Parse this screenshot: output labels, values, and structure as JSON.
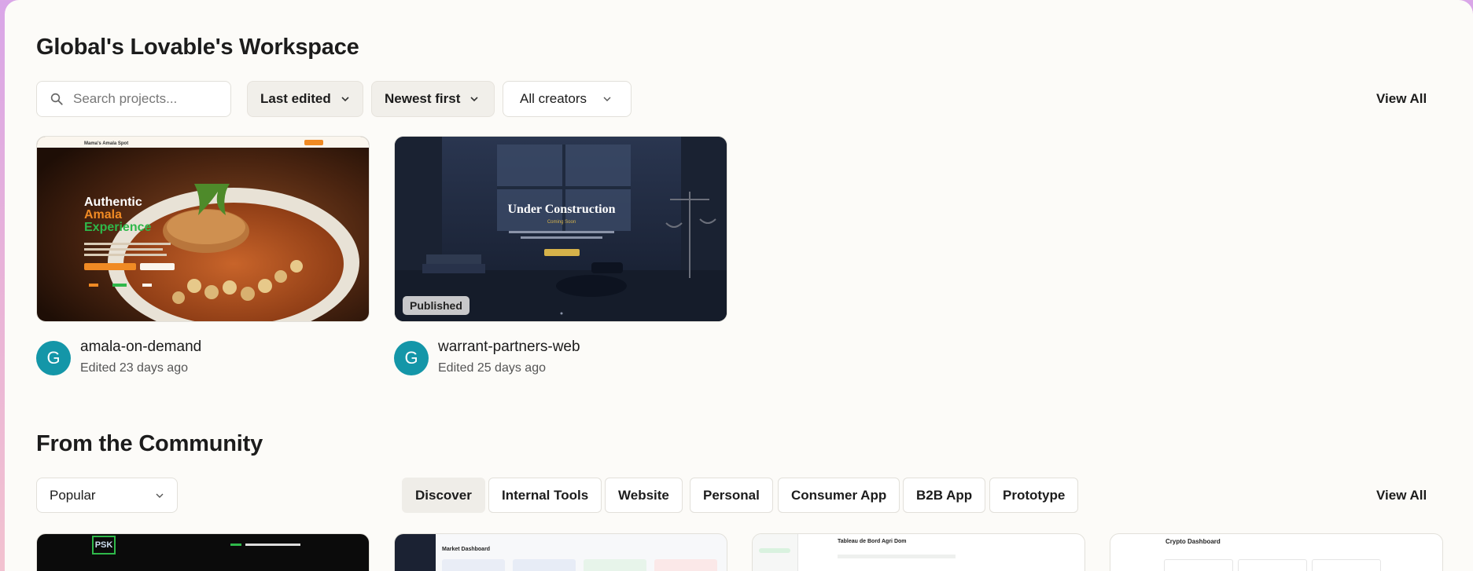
{
  "workspace": {
    "title": "Global's Lovable's Workspace",
    "search_placeholder": "Search projects...",
    "sort_field": "Last edited",
    "sort_order": "Newest first",
    "creators_filter": "All creators",
    "view_all": "View All",
    "projects": [
      {
        "avatar_letter": "G",
        "name": "amala-on-demand",
        "edited": "Edited 23 days ago",
        "thumb": {
          "brand": "Mama's Amala Spot",
          "headline_1": "Authentic",
          "headline_2": "Amala",
          "headline_3": "Experience"
        }
      },
      {
        "avatar_letter": "G",
        "name": "warrant-partners-web",
        "edited": "Edited 25 days ago",
        "badge": "Published",
        "thumb": {
          "headline": "Under Construction",
          "sub": "Coming Soon"
        }
      }
    ]
  },
  "community": {
    "title": "From the Community",
    "sort_value": "Popular",
    "view_all": "View All",
    "categories": [
      "Discover",
      "Internal Tools",
      "Website",
      "Personal",
      "Consumer App",
      "B2B App",
      "Prototype"
    ],
    "active_category": "Discover",
    "cards": [
      {
        "thumb_label": "PSK"
      },
      {
        "thumb_label": "Market Dashboard"
      },
      {
        "thumb_label": "Tableau de Bord Agri Dom"
      },
      {
        "thumb_label": "Crypto Dashboard"
      }
    ]
  },
  "colors": {
    "panel_bg": "#fcfbf8",
    "avatar": "#1496a8",
    "accent_orange": "#f08a24",
    "accent_green": "#2fb84a"
  }
}
